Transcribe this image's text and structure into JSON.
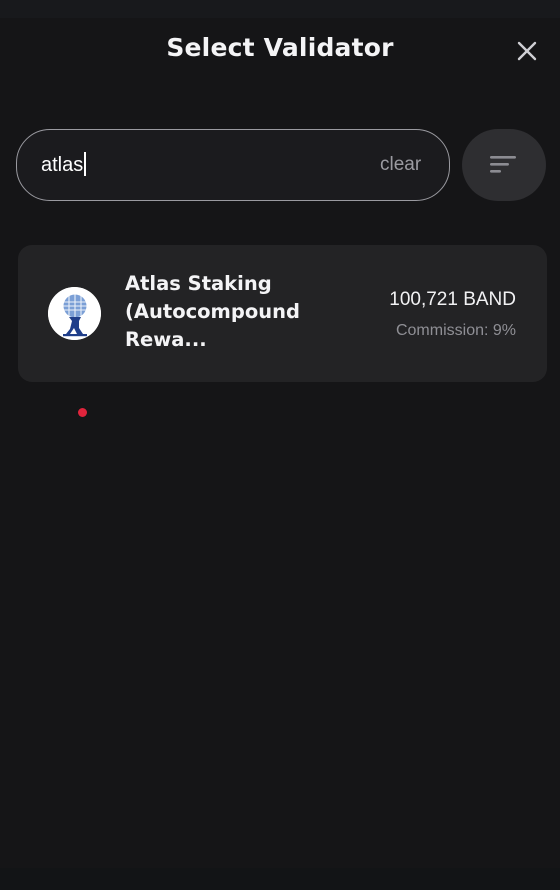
{
  "modal": {
    "title": "Select Validator",
    "close_icon": "close-icon"
  },
  "search": {
    "value": "atlas",
    "clear_label": "clear",
    "filter_icon": "filter-icon"
  },
  "validators": [
    {
      "name": "Atlas Staking (Autocompound Rewa...",
      "amount": "100,721 BAND",
      "commission": "Commission: 9%",
      "avatar_icon": "atlas-logo-icon"
    }
  ],
  "colors": {
    "background": "#151517",
    "card": "#232325",
    "search_border": "#9a9aa0",
    "muted_text": "#8f8f95",
    "pointer": "#e0243c"
  }
}
